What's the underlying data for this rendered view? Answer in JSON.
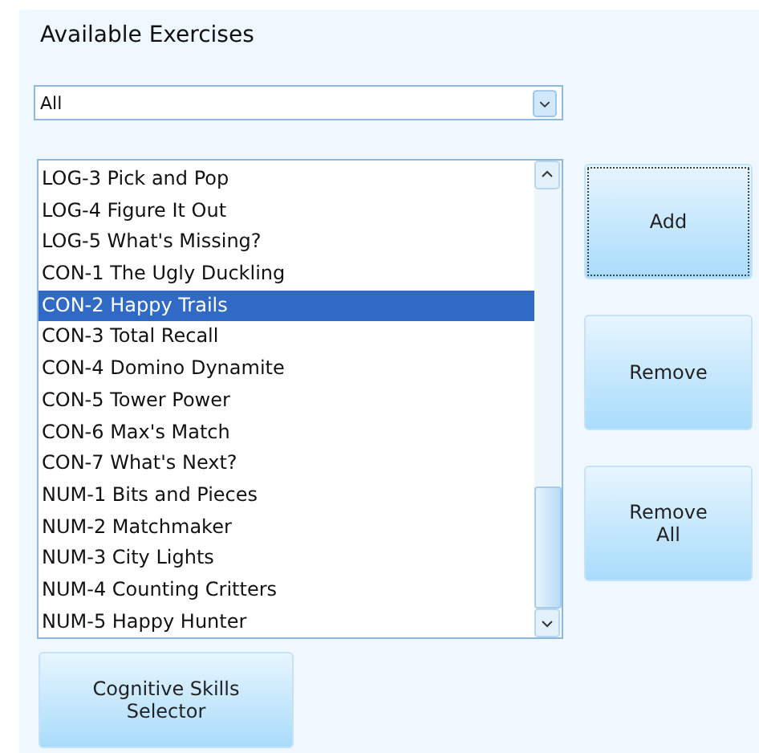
{
  "title": "Available Exercises",
  "filter": {
    "value": "All"
  },
  "exercises": [
    {
      "label": "LOG-3 Pick and Pop",
      "selected": false
    },
    {
      "label": "LOG-4 Figure It Out",
      "selected": false
    },
    {
      "label": "LOG-5 What's Missing?",
      "selected": false
    },
    {
      "label": "CON-1 The Ugly Duckling",
      "selected": false
    },
    {
      "label": "CON-2 Happy Trails",
      "selected": true
    },
    {
      "label": "CON-3 Total Recall",
      "selected": false
    },
    {
      "label": "CON-4 Domino Dynamite",
      "selected": false
    },
    {
      "label": "CON-5 Tower Power",
      "selected": false
    },
    {
      "label": "CON-6 Max's Match",
      "selected": false
    },
    {
      "label": "CON-7 What's Next?",
      "selected": false
    },
    {
      "label": "NUM-1 Bits and Pieces",
      "selected": false
    },
    {
      "label": "NUM-2 Matchmaker",
      "selected": false
    },
    {
      "label": "NUM-3 City Lights",
      "selected": false
    },
    {
      "label": "NUM-4 Counting Critters",
      "selected": false
    },
    {
      "label": "NUM-5 Happy Hunter",
      "selected": false
    }
  ],
  "side_buttons": [
    {
      "label": "Add",
      "focused": true
    },
    {
      "label": "Remove",
      "focused": false
    },
    {
      "label": "Remove\nAll",
      "focused": false
    }
  ],
  "bottom_button": {
    "label": "Cognitive Skills\nSelector"
  }
}
